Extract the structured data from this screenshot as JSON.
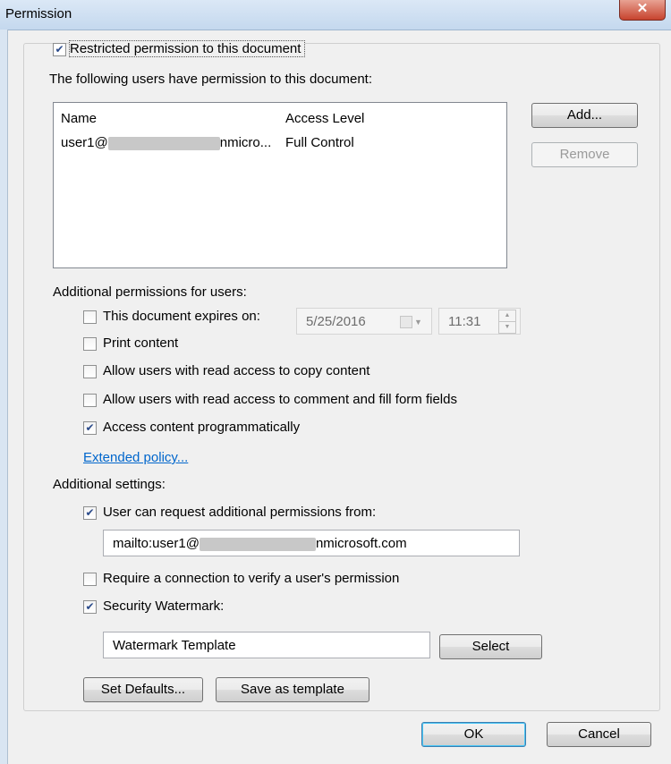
{
  "window": {
    "title": "Permission",
    "close_glyph": "✕"
  },
  "restricted": {
    "label": "Restricted permission to this document",
    "checked": true
  },
  "users_caption": "The following users have permission to this document:",
  "user_list": {
    "headers": [
      "Name",
      "Access Level"
    ],
    "rows": [
      {
        "name_prefix": "user1@",
        "name_suffix": "nmicro...",
        "access": "Full Control"
      }
    ]
  },
  "buttons": {
    "add": "Add...",
    "remove": "Remove",
    "set_defaults": "Set Defaults...",
    "save_template": "Save as template",
    "ok": "OK",
    "cancel": "Cancel",
    "select": "Select"
  },
  "additional_permissions": {
    "caption": "Additional permissions for users:",
    "expires": {
      "label": "This document expires on:",
      "checked": false,
      "date": "5/25/2016",
      "time": "11:31"
    },
    "print": {
      "label": "Print content",
      "checked": false
    },
    "copy": {
      "label": "Allow users with read access to copy content",
      "checked": false
    },
    "comment": {
      "label": "Allow users with read access to comment and fill form fields",
      "checked": false
    },
    "programmatic": {
      "label": "Access content programmatically",
      "checked": true
    },
    "extended_policy": "Extended policy..."
  },
  "additional_settings": {
    "caption": "Additional settings:",
    "request": {
      "label": "User can request additional permissions from:",
      "checked": true,
      "value_prefix": "mailto:user1@",
      "value_suffix": "nmicrosoft.com"
    },
    "require_connection": {
      "label": "Require a connection to verify a user's permission",
      "checked": false
    },
    "watermark": {
      "label": "Security Watermark:",
      "checked": true,
      "value": "Watermark Template"
    }
  },
  "icons": {
    "check": "check-icon",
    "calendar": "calendar-dropdown-icon",
    "spin": "spin-arrows-icon",
    "close": "close-icon"
  }
}
